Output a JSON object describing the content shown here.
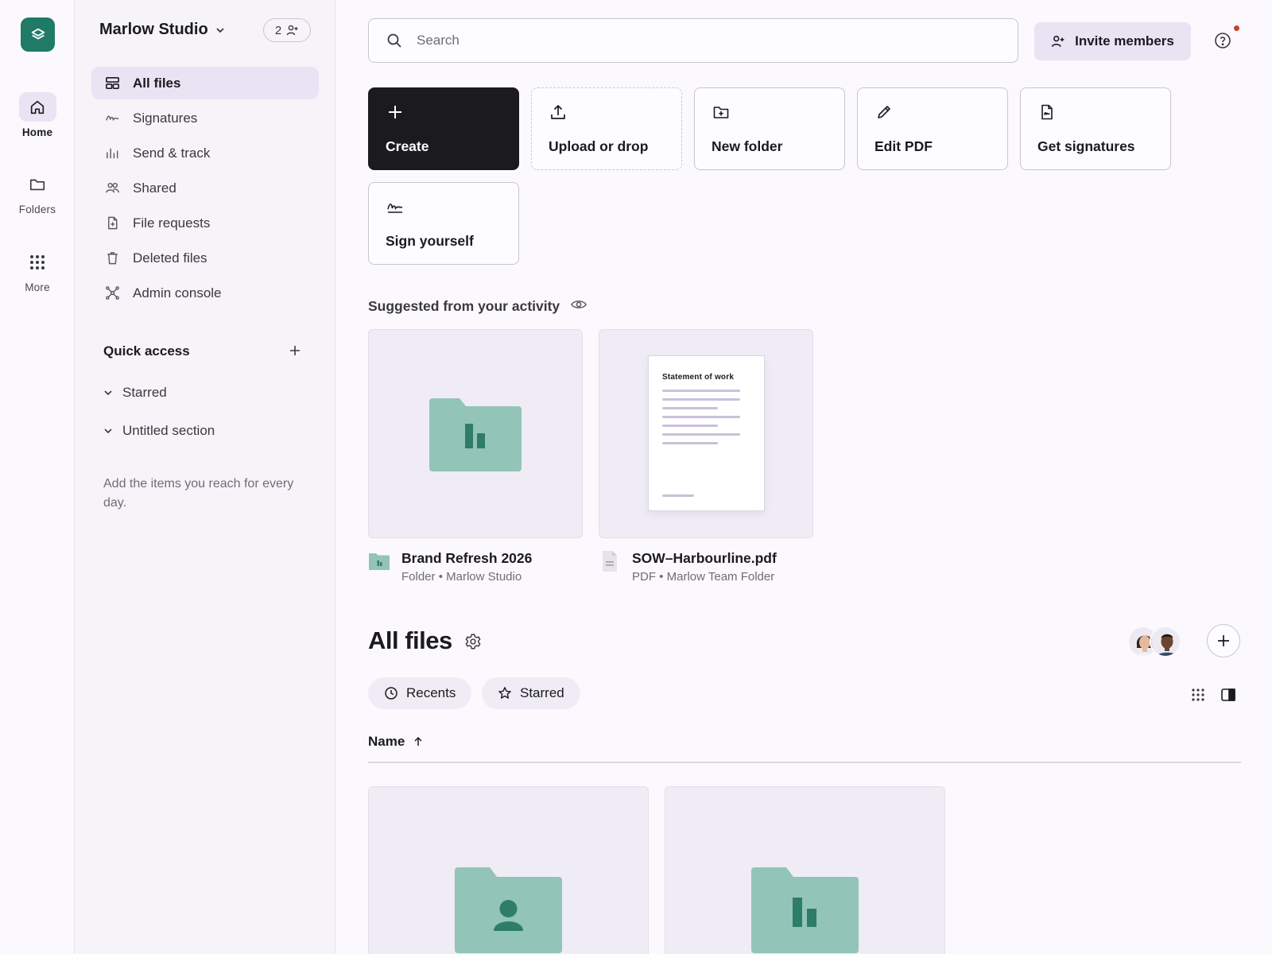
{
  "rail": {
    "items": [
      {
        "label": "Home",
        "icon": "home-icon"
      },
      {
        "label": "Folders",
        "icon": "folder-icon"
      },
      {
        "label": "More",
        "icon": "apps-grid-icon"
      }
    ]
  },
  "sidebar": {
    "team_name": "Marlow Studio",
    "member_count": "2",
    "nav": [
      {
        "label": "All files",
        "icon": "all-files-icon"
      },
      {
        "label": "Signatures",
        "icon": "signature-icon"
      },
      {
        "label": "Send & track",
        "icon": "bar-chart-icon"
      },
      {
        "label": "Shared",
        "icon": "people-icon"
      },
      {
        "label": "File requests",
        "icon": "file-request-icon"
      },
      {
        "label": "Deleted files",
        "icon": "trash-icon"
      },
      {
        "label": "Admin console",
        "icon": "network-icon"
      }
    ],
    "quick_access": {
      "title": "Quick access",
      "sections": [
        "Starred",
        "Untitled section"
      ],
      "hint": "Add the items you reach for every day."
    }
  },
  "search": {
    "placeholder": "Search",
    "value": ""
  },
  "header": {
    "invite_label": "Invite members"
  },
  "actions": [
    {
      "label": "Create",
      "icon": "plus-icon"
    },
    {
      "label": "Upload or drop",
      "icon": "upload-icon"
    },
    {
      "label": "New folder",
      "icon": "new-folder-icon"
    },
    {
      "label": "Edit PDF",
      "icon": "pencil-icon"
    },
    {
      "label": "Get signatures",
      "icon": "signature-doc-icon"
    },
    {
      "label": "Sign yourself",
      "icon": "signature-icon"
    }
  ],
  "suggested": {
    "title": "Suggested from your activity",
    "items": [
      {
        "name": "Brand Refresh 2026",
        "type": "Folder",
        "location": "Marlow Studio",
        "sep": "•"
      },
      {
        "name": "SOW–Harbourline.pdf",
        "type": "PDF",
        "location": "Marlow Team Folder",
        "sep": "•",
        "preview_title": "Statement of work"
      }
    ]
  },
  "all_files": {
    "title": "All files",
    "filters": [
      "Recents",
      "Starred"
    ],
    "sort_label": "Name",
    "sort_direction": "ascending"
  },
  "colors": {
    "brand": "#1f7a66",
    "folder": "#92c4b7",
    "folder_mark": "#2e7d68",
    "accent_bg": "#e9e3f3",
    "notification": "#c4432f"
  }
}
